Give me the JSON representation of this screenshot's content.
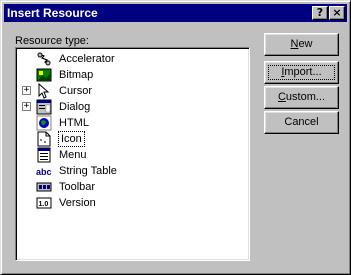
{
  "window": {
    "title": "Insert Resource",
    "help_glyph": "?",
    "close_glyph": "×"
  },
  "resource_label": "Resource type:",
  "resources": [
    {
      "label": "Accelerator",
      "icon": "accelerator-icon",
      "expandable": false
    },
    {
      "label": "Bitmap",
      "icon": "bitmap-icon",
      "expandable": false
    },
    {
      "label": "Cursor",
      "icon": "cursor-icon",
      "expandable": true
    },
    {
      "label": "Dialog",
      "icon": "dialog-icon",
      "expandable": true
    },
    {
      "label": "HTML",
      "icon": "html-icon",
      "expandable": false
    },
    {
      "label": "Icon",
      "icon": "icon-resource-icon",
      "expandable": false,
      "selected": true
    },
    {
      "label": "Menu",
      "icon": "menu-icon",
      "expandable": false
    },
    {
      "label": "String Table",
      "icon": "string-table-icon",
      "expandable": false
    },
    {
      "label": "Toolbar",
      "icon": "toolbar-icon",
      "expandable": false
    },
    {
      "label": "Version",
      "icon": "version-icon",
      "expandable": false
    }
  ],
  "buttons": {
    "new": {
      "pre": "",
      "mnemonic": "N",
      "post": "ew"
    },
    "import": {
      "pre": "",
      "mnemonic": "I",
      "post": "mport..."
    },
    "custom": {
      "pre": "",
      "mnemonic": "C",
      "post": "ustom..."
    },
    "cancel": {
      "label": "Cancel"
    }
  },
  "expander_glyph": "+",
  "icon_glyphs": {
    "string_table": "abc",
    "version": "1.0"
  }
}
